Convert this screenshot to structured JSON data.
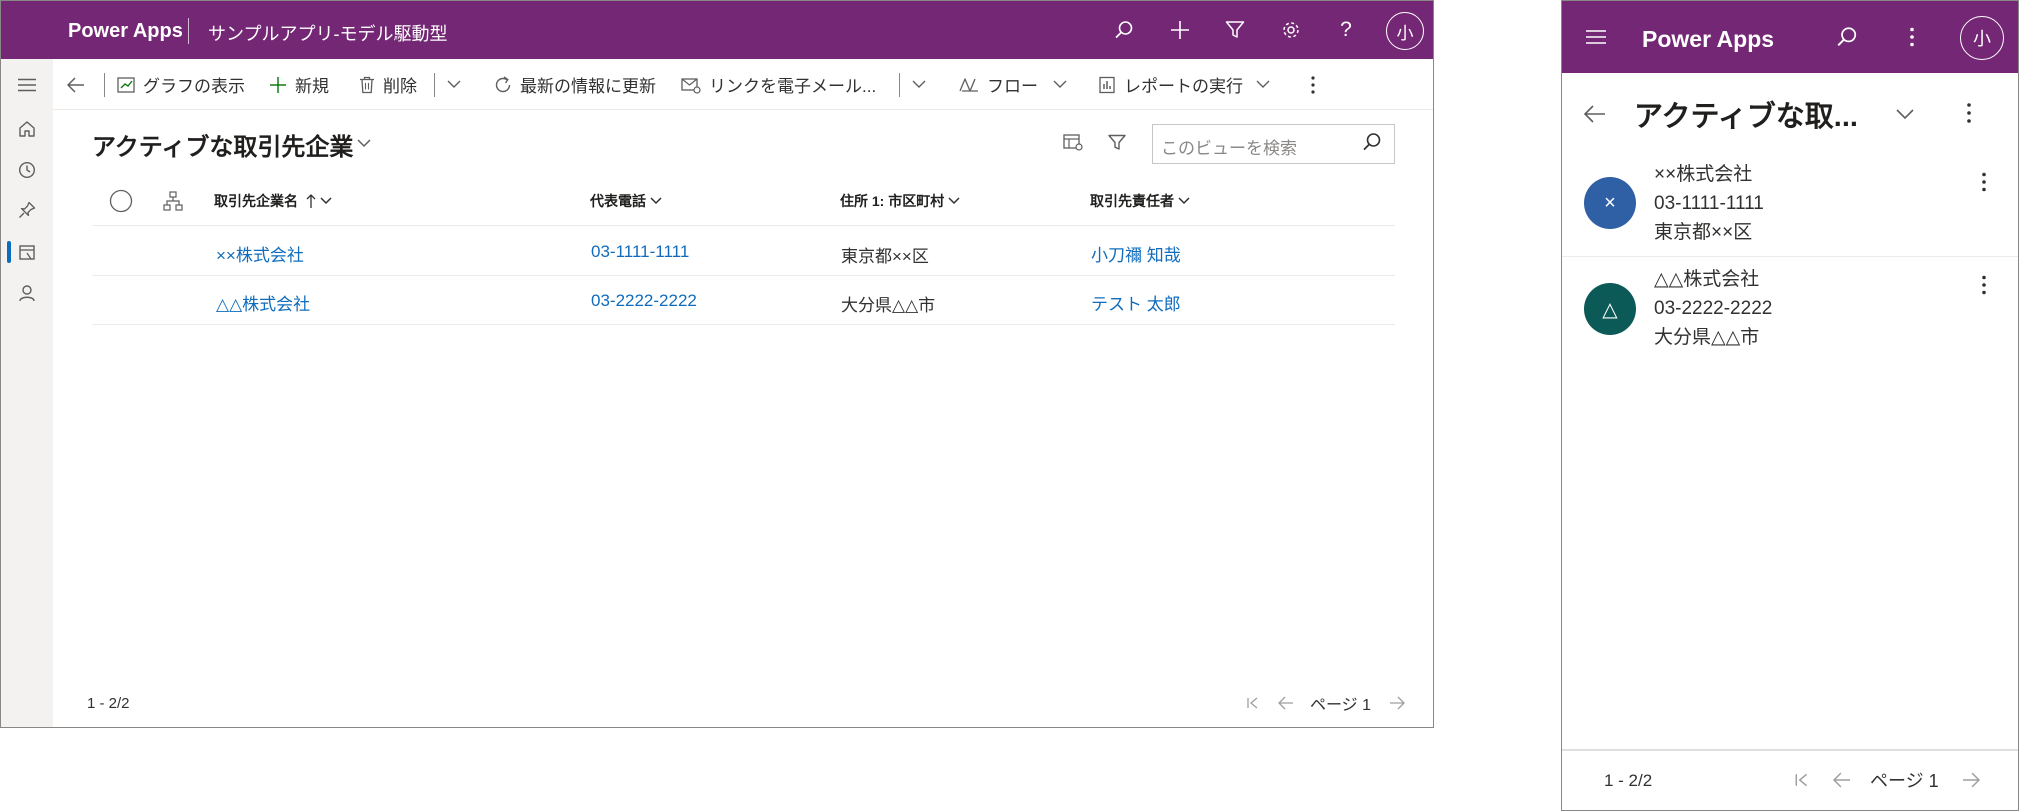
{
  "desktop": {
    "header": {
      "brand": "Power Apps",
      "app_name": "サンプルアプリ-モデル駆動型",
      "avatar": "小"
    },
    "rail": {
      "items": [
        "hamburger-icon",
        "home-icon",
        "recent-icon",
        "pin-icon",
        "entity-icon",
        "contact-icon"
      ]
    },
    "command_bar": {
      "show_chart": "グラフの表示",
      "new": "新規",
      "delete": "削除",
      "refresh": "最新の情報に更新",
      "email_link": "リンクを電子メール...",
      "flow": "フロー",
      "run_report": "レポートの実行"
    },
    "view": {
      "title": "アクティブな取引先企業",
      "search_placeholder": "このビューを検索"
    },
    "table": {
      "columns": {
        "name": "取引先企業名",
        "phone": "代表電話",
        "city": "住所 1: 市区町村",
        "contact": "取引先責任者"
      },
      "rows": [
        {
          "name": "××株式会社",
          "phone": "03-1111-1111",
          "city": "東京都××区",
          "contact": "小刀禰 知哉"
        },
        {
          "name": "△△株式会社",
          "phone": "03-2222-2222",
          "city": "大分県△△市",
          "contact": "テスト 太郎"
        }
      ]
    },
    "footer": {
      "count": "1 - 2/2",
      "page": "ページ 1"
    }
  },
  "mobile": {
    "header": {
      "brand": "Power Apps",
      "avatar": "小"
    },
    "view": {
      "title": "アクティブな取..."
    },
    "items": [
      {
        "initial": "×",
        "color": "#2f5fa5",
        "name": "××株式会社",
        "phone": "03-1111-1111",
        "city": "東京都××区"
      },
      {
        "initial": "△",
        "color": "#0c5a57",
        "name": "△△株式会社",
        "phone": "03-2222-2222",
        "city": "大分県△△市"
      }
    ],
    "footer": {
      "count": "1 - 2/2",
      "page": "ページ 1"
    }
  },
  "colors": {
    "header_bg": "#742774",
    "link": "#0f6cbd"
  }
}
